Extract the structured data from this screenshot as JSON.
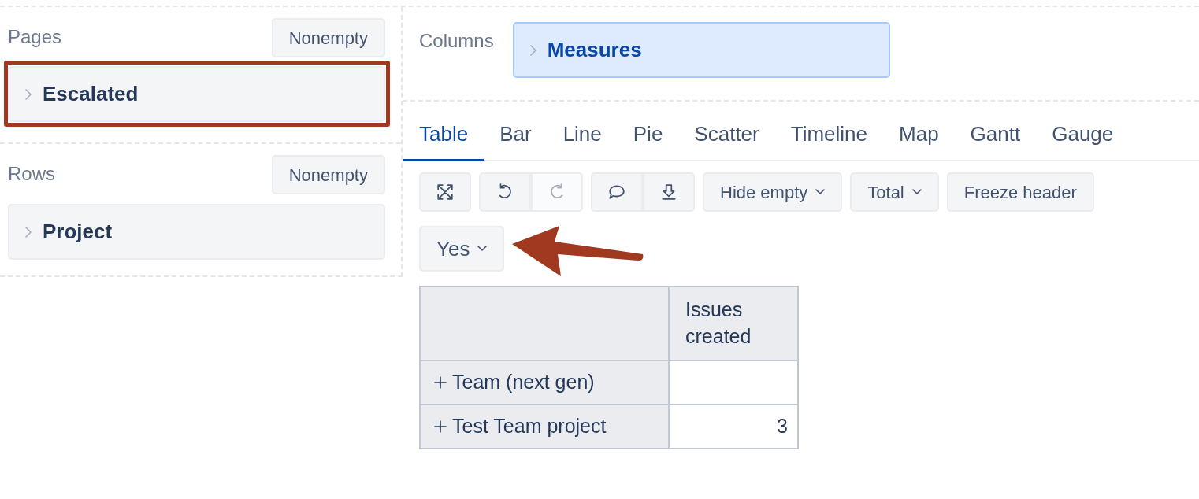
{
  "sections": [
    {
      "label": "Pages",
      "button": "Nonempty",
      "items": [
        {
          "label": "Escalated",
          "kind": "dimension",
          "highlighted": true
        }
      ]
    },
    {
      "label": "Rows",
      "button": "Nonempty",
      "items": [
        {
          "label": "Project",
          "kind": "dimension",
          "highlighted": false
        }
      ]
    }
  ],
  "columns": {
    "label": "Columns",
    "items": [
      {
        "label": "Measures",
        "kind": "measures",
        "highlighted": false
      }
    ]
  },
  "tabs": [
    {
      "label": "Table",
      "selected": true
    },
    {
      "label": "Bar",
      "selected": false
    },
    {
      "label": "Line",
      "selected": false
    },
    {
      "label": "Pie",
      "selected": false
    },
    {
      "label": "Scatter",
      "selected": false
    },
    {
      "label": "Timeline",
      "selected": false
    },
    {
      "label": "Map",
      "selected": false
    },
    {
      "label": "Gantt",
      "selected": false
    },
    {
      "label": "Gauge",
      "selected": false
    }
  ],
  "toolbar": [
    {
      "kind": "icons",
      "buttons": [
        {
          "disabled": false
        }
      ]
    },
    {
      "kind": "icons",
      "buttons": [
        {
          "disabled": false
        },
        {
          "disabled": true
        }
      ]
    },
    {
      "kind": "icons",
      "buttons": [
        {
          "disabled": false
        },
        {
          "disabled": false
        }
      ]
    },
    {
      "kind": "dropdown",
      "label": "Hide empty"
    },
    {
      "kind": "dropdown",
      "label": "Total"
    },
    {
      "kind": "button",
      "label": "Freeze header"
    }
  ],
  "page_filter": {
    "label": "Yes"
  },
  "table": {
    "columns": [
      "Issues created"
    ],
    "rows": [
      {
        "label": "Team (next gen)"
      },
      {
        "label": "Test Team project",
        "value": "3"
      }
    ]
  }
}
